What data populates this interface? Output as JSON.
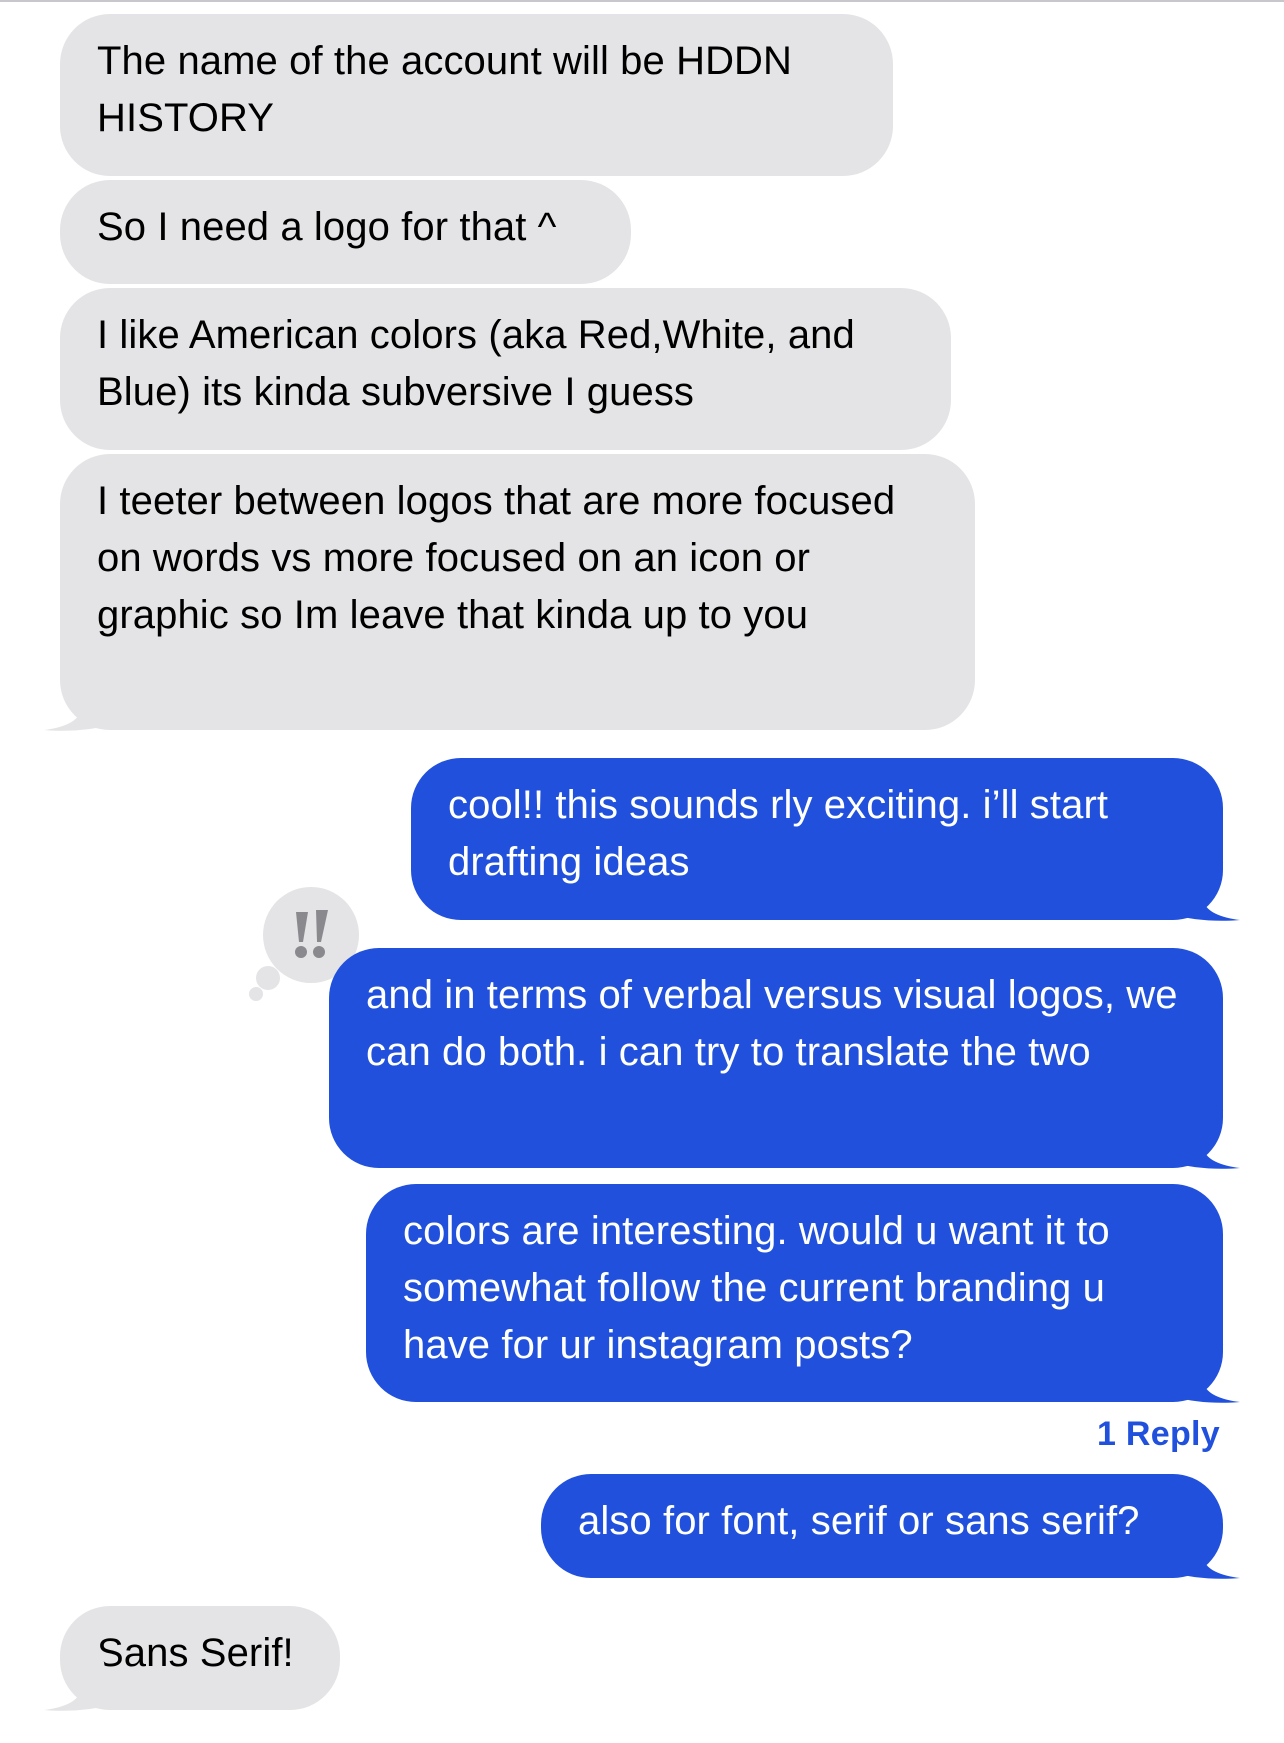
{
  "thread": {
    "messages": [
      {
        "direction": "incoming",
        "text": "The name of the account will be HDDN HISTORY"
      },
      {
        "direction": "incoming",
        "text": "So I need a logo for that ^"
      },
      {
        "direction": "incoming",
        "text": "I like American colors (aka Red,White, and Blue) its kinda subversive I guess"
      },
      {
        "direction": "incoming",
        "text": "I teeter between logos that are more focused on words vs more focused on an icon or graphic so Im leave that kinda up to you"
      },
      {
        "direction": "outgoing",
        "text": "cool!! this sounds rly exciting. i’ll start drafting ideas"
      },
      {
        "direction": "outgoing",
        "text": "and in terms of verbal versus visual logos, we can do both. i can try to translate the two",
        "tapback": "!!"
      },
      {
        "direction": "outgoing",
        "text": "colors are interesting. would u want it to somewhat follow the current branding u have for ur instagram posts?"
      },
      {
        "direction": "outgoing",
        "text": "also for font, serif or sans serif?"
      },
      {
        "direction": "incoming",
        "text": "Sans Serif!"
      }
    ],
    "reply_count_label": "1 Reply"
  },
  "colors": {
    "incoming_bubble": "#e4e4e6",
    "outgoing_bubble": "#2151dc",
    "tapback_bubble": "#e4e4e6",
    "tapback_glyph": "#8a8a8e"
  },
  "icons": {
    "tapback": "double-exclamation-icon"
  }
}
